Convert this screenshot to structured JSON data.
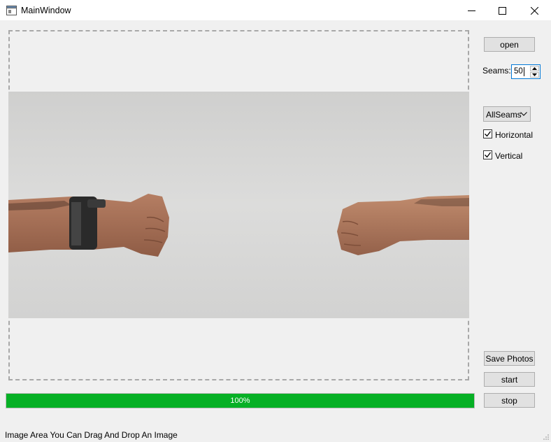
{
  "window": {
    "title": "MainWindow",
    "icons": {
      "app": "window-app-icon",
      "minimize": "minimize-icon",
      "maximize": "maximize-icon",
      "close": "close-icon"
    }
  },
  "image_area": {
    "photo_description_icon": "image-photo"
  },
  "controls": {
    "open_label": "open",
    "seams_label": "Seams:",
    "seams_value": "50",
    "mode_value": "AllSeams",
    "horizontal_label": "Horizontal",
    "horizontal_checked": true,
    "vertical_label": "Vertical",
    "vertical_checked": true,
    "save_label": "Save Photos",
    "start_label": "start",
    "stop_label": "stop"
  },
  "progress": {
    "value": 1.0,
    "text": "100%",
    "color": "#06b025"
  },
  "status": {
    "text": "Image Area You Can Drag And Drop An Image"
  },
  "colors": {
    "focus_border": "#0078d7",
    "progress_fill": "#06b025"
  }
}
